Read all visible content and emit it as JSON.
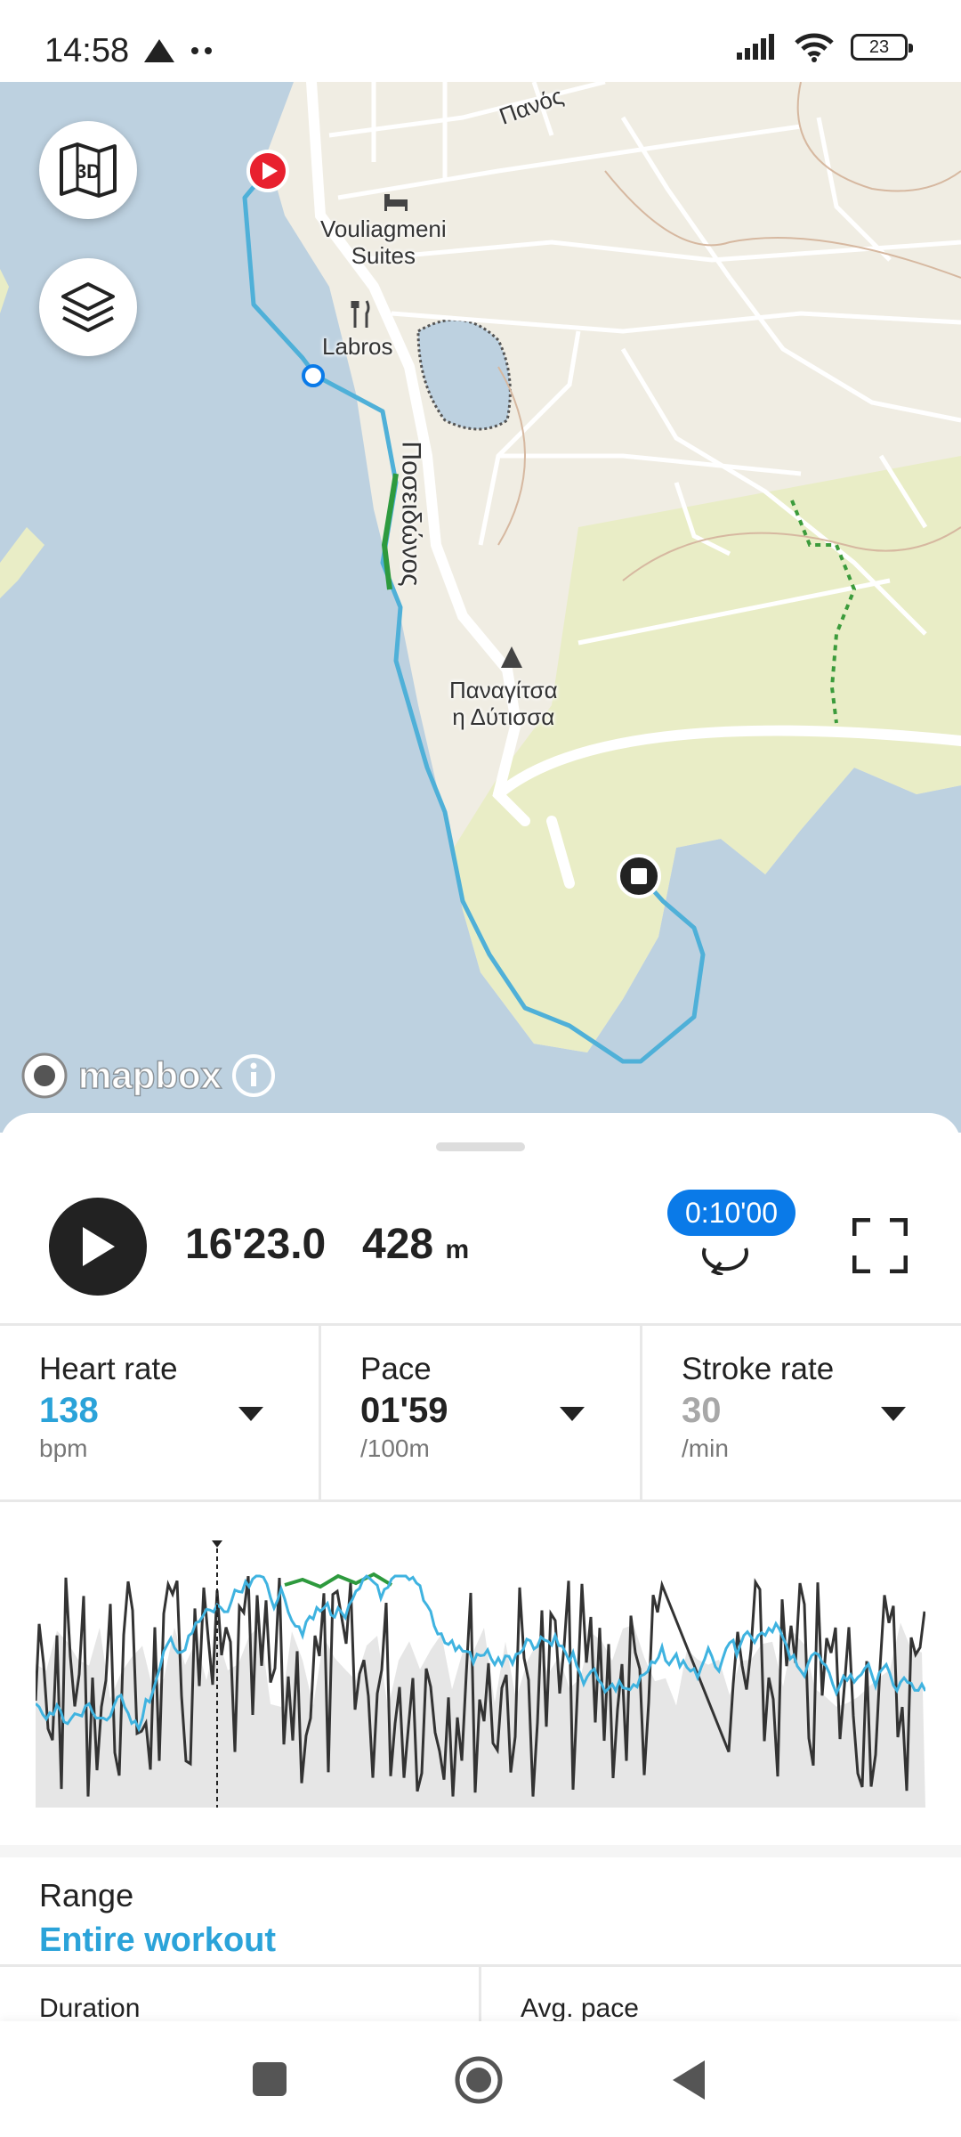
{
  "status_bar": {
    "time": "14:58",
    "battery": "23"
  },
  "map": {
    "labels": {
      "panos": "Πανός",
      "hotel_line1": "Vouliagmeni",
      "hotel_line2": "Suites",
      "restaurant": "Labros",
      "road": "Ποσειδώνος",
      "church_line1": "Παναγίτσα",
      "church_line2": "η Δύτισσα"
    },
    "buttons": {
      "three_d": "3D"
    },
    "attribution": "mapbox"
  },
  "workout": {
    "duration": "16'23.0",
    "distance": "428",
    "distance_unit": "m",
    "interval_badge": "0:10'00"
  },
  "metrics": [
    {
      "label": "Heart rate",
      "value": "138",
      "unit": "bpm",
      "color": "#2ba3d9"
    },
    {
      "label": "Pace",
      "value": "01'59",
      "unit": "/100m",
      "color": "#222222"
    },
    {
      "label": "Stroke rate",
      "value": "30",
      "unit": "/min",
      "color": "#a8a8a8"
    }
  ],
  "range": {
    "label": "Range",
    "value": "Entire workout"
  },
  "stats": {
    "left_label": "Duration",
    "right_label": "Avg. pace"
  },
  "colors": {
    "route": "#4fb0d8",
    "accent": "#2ba3d9",
    "badge": "#0a7ae8",
    "start_marker": "#e8202e"
  }
}
